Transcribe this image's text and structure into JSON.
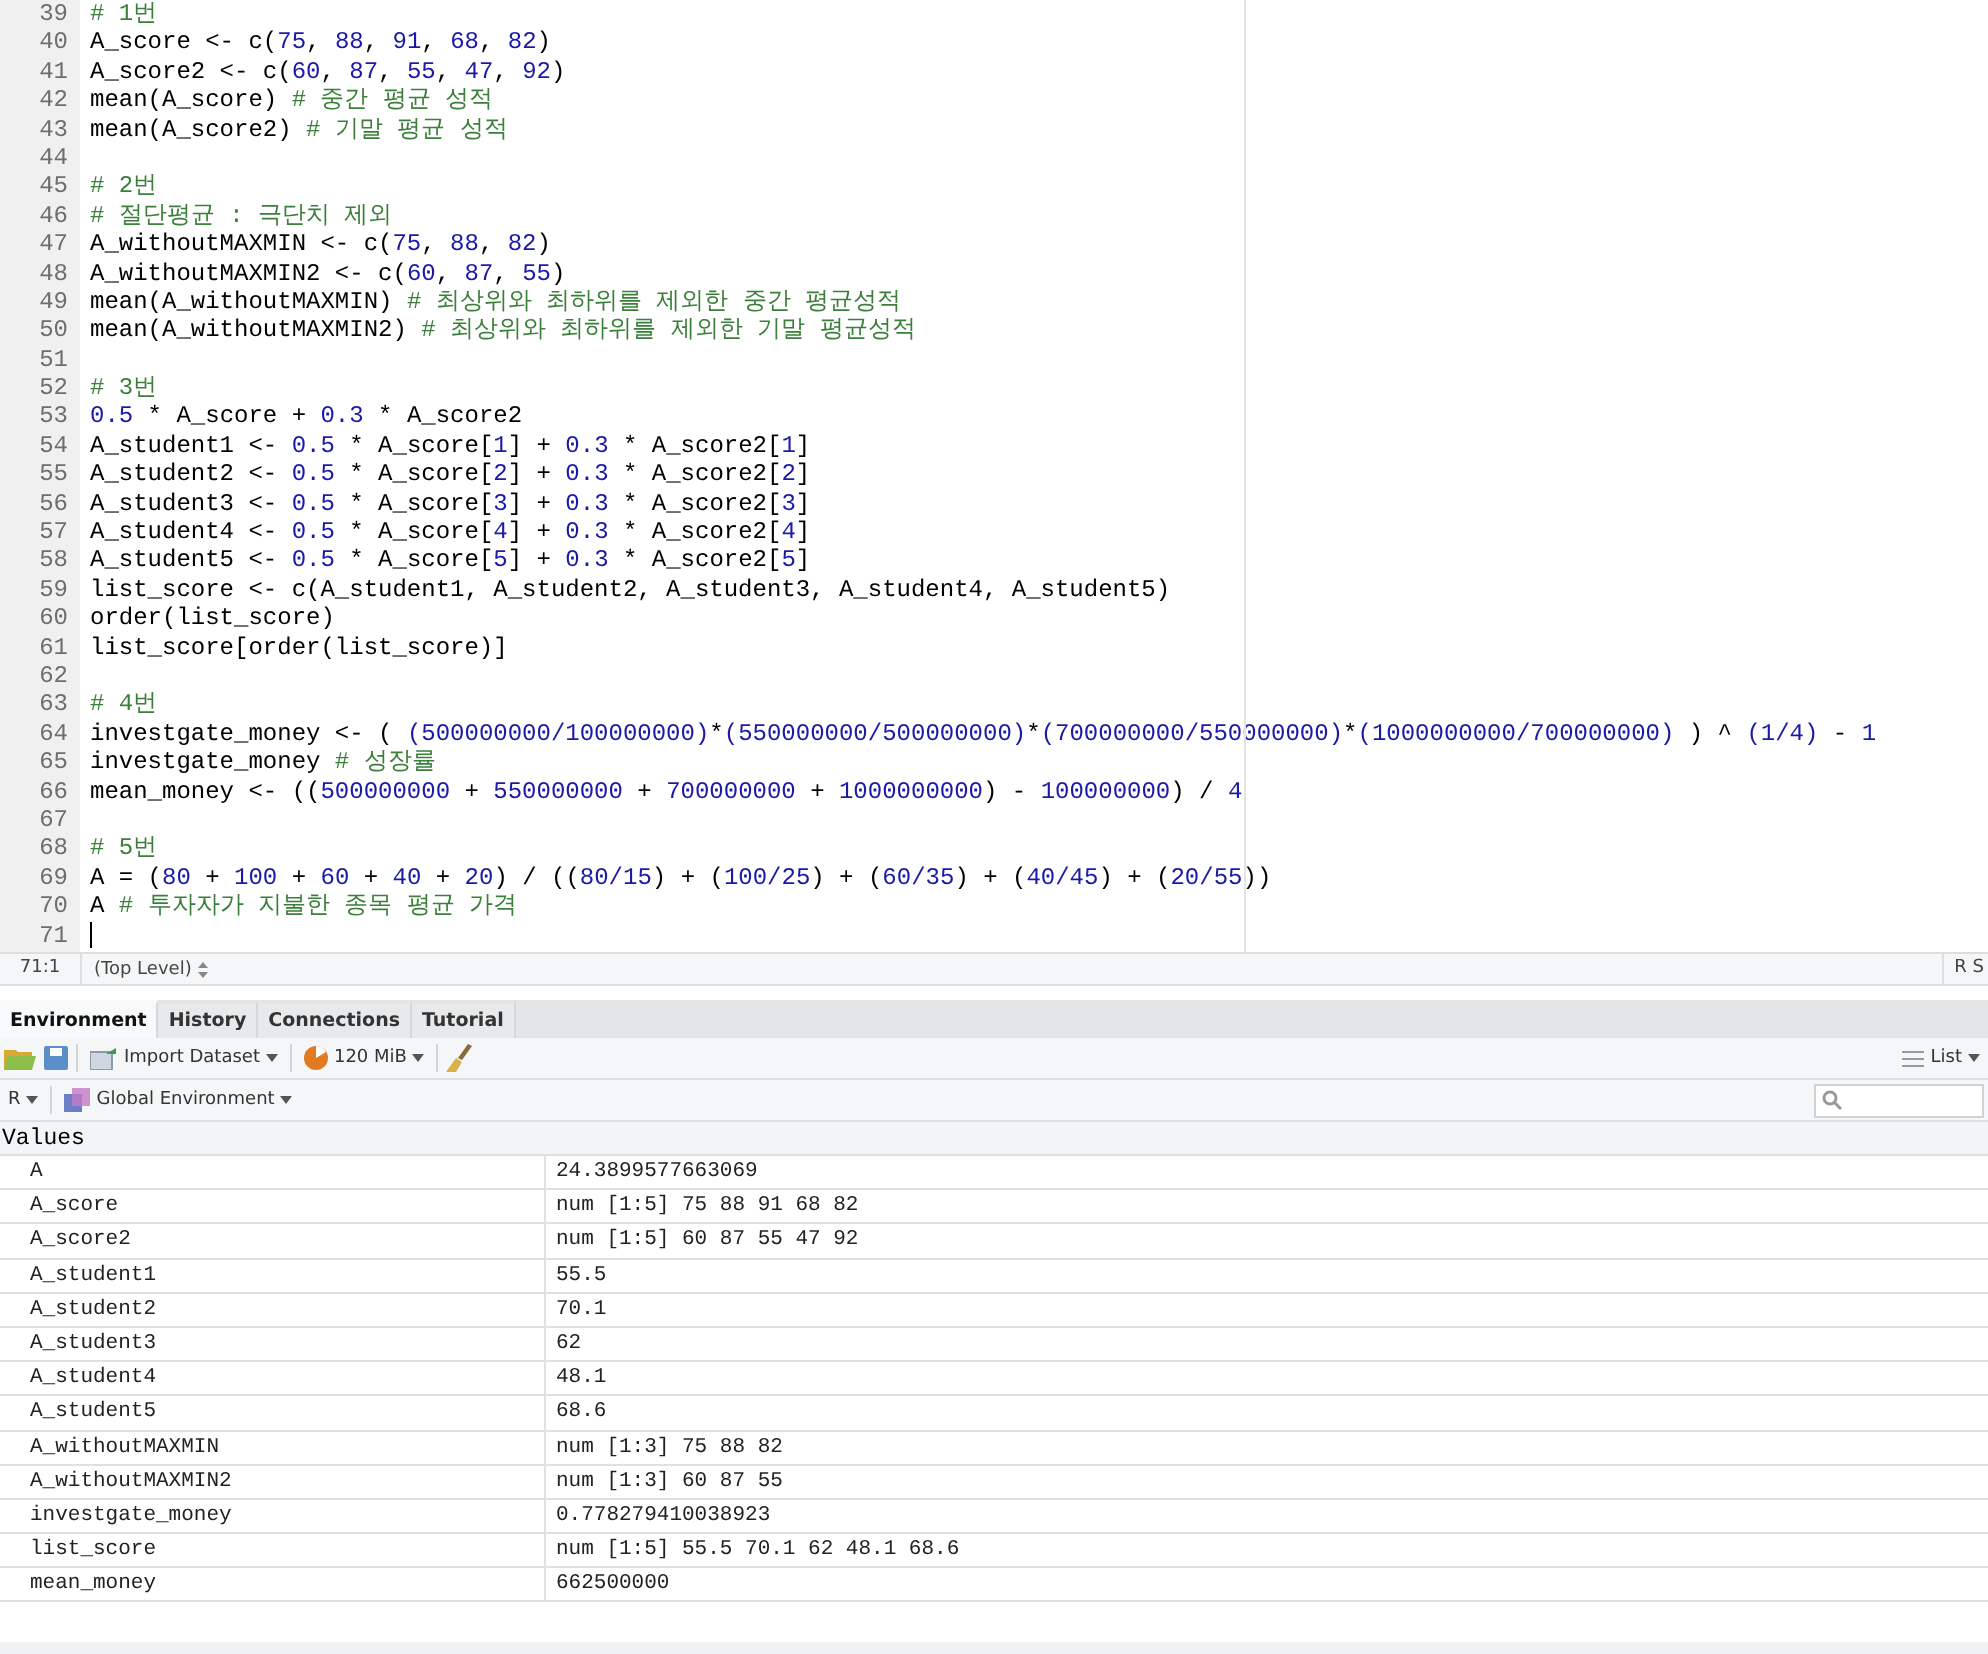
{
  "editor": {
    "lines": [
      {
        "number": "39",
        "segments": [
          {
            "kind": "comment",
            "text": "# 1번"
          }
        ]
      },
      {
        "number": "40",
        "segments": [
          {
            "kind": "code",
            "text": "A_score <- c("
          },
          {
            "kind": "number",
            "text": "75"
          },
          {
            "kind": "code",
            "text": ", "
          },
          {
            "kind": "number",
            "text": "88"
          },
          {
            "kind": "code",
            "text": ", "
          },
          {
            "kind": "number",
            "text": "91"
          },
          {
            "kind": "code",
            "text": ", "
          },
          {
            "kind": "number",
            "text": "68"
          },
          {
            "kind": "code",
            "text": ", "
          },
          {
            "kind": "number",
            "text": "82"
          },
          {
            "kind": "code",
            "text": ")"
          }
        ]
      },
      {
        "number": "41",
        "segments": [
          {
            "kind": "code",
            "text": "A_score2 <- c("
          },
          {
            "kind": "number",
            "text": "60"
          },
          {
            "kind": "code",
            "text": ", "
          },
          {
            "kind": "number",
            "text": "87"
          },
          {
            "kind": "code",
            "text": ", "
          },
          {
            "kind": "number",
            "text": "55"
          },
          {
            "kind": "code",
            "text": ", "
          },
          {
            "kind": "number",
            "text": "47"
          },
          {
            "kind": "code",
            "text": ", "
          },
          {
            "kind": "number",
            "text": "92"
          },
          {
            "kind": "code",
            "text": ")"
          }
        ]
      },
      {
        "number": "42",
        "segments": [
          {
            "kind": "code",
            "text": "mean(A_score) "
          },
          {
            "kind": "comment",
            "text": "# 중간 평균 성적"
          }
        ]
      },
      {
        "number": "43",
        "segments": [
          {
            "kind": "code",
            "text": "mean(A_score2) "
          },
          {
            "kind": "comment",
            "text": "# 기말 평균 성적"
          }
        ]
      },
      {
        "number": "44"
      },
      {
        "number": "45",
        "segments": [
          {
            "kind": "comment",
            "text": "# 2번"
          }
        ]
      },
      {
        "number": "46",
        "segments": [
          {
            "kind": "comment",
            "text": "# 절단평균 : 극단치 제외"
          }
        ]
      },
      {
        "number": "47",
        "segments": [
          {
            "kind": "code",
            "text": "A_withoutMAXMIN <- c("
          },
          {
            "kind": "number",
            "text": "75"
          },
          {
            "kind": "code",
            "text": ", "
          },
          {
            "kind": "number",
            "text": "88"
          },
          {
            "kind": "code",
            "text": ", "
          },
          {
            "kind": "number",
            "text": "82"
          },
          {
            "kind": "code",
            "text": ")"
          }
        ]
      },
      {
        "number": "48",
        "segments": [
          {
            "kind": "code",
            "text": "A_withoutMAXMIN2 <- c("
          },
          {
            "kind": "number",
            "text": "60"
          },
          {
            "kind": "code",
            "text": ", "
          },
          {
            "kind": "number",
            "text": "87"
          },
          {
            "kind": "code",
            "text": ", "
          },
          {
            "kind": "number",
            "text": "55"
          },
          {
            "kind": "code",
            "text": ")"
          }
        ]
      },
      {
        "number": "49",
        "segments": [
          {
            "kind": "code",
            "text": "mean(A_withoutMAXMIN) "
          },
          {
            "kind": "comment",
            "text": "# 최상위와 최하위를 제외한 중간 평균성적"
          }
        ]
      },
      {
        "number": "50",
        "segments": [
          {
            "kind": "code",
            "text": "mean(A_withoutMAXMIN2) "
          },
          {
            "kind": "comment",
            "text": "# 최상위와 최하위를 제외한 기말 평균성적"
          }
        ]
      },
      {
        "number": "51"
      },
      {
        "number": "52",
        "segments": [
          {
            "kind": "comment",
            "text": "# 3번"
          }
        ]
      },
      {
        "number": "53",
        "segments": [
          {
            "kind": "number",
            "text": "0.5"
          },
          {
            "kind": "code",
            "text": " * A_score + "
          },
          {
            "kind": "number",
            "text": "0.3"
          },
          {
            "kind": "code",
            "text": " * A_score2"
          }
        ]
      },
      {
        "number": "54",
        "segments": [
          {
            "kind": "code",
            "text": "A_student1 <- "
          },
          {
            "kind": "number",
            "text": "0.5"
          },
          {
            "kind": "code",
            "text": " * A_score["
          },
          {
            "kind": "number",
            "text": "1"
          },
          {
            "kind": "code",
            "text": "] + "
          },
          {
            "kind": "number",
            "text": "0.3"
          },
          {
            "kind": "code",
            "text": " * A_score2["
          },
          {
            "kind": "number",
            "text": "1"
          },
          {
            "kind": "code",
            "text": "]"
          }
        ]
      },
      {
        "number": "55",
        "segments": [
          {
            "kind": "code",
            "text": "A_student2 <- "
          },
          {
            "kind": "number",
            "text": "0.5"
          },
          {
            "kind": "code",
            "text": " * A_score["
          },
          {
            "kind": "number",
            "text": "2"
          },
          {
            "kind": "code",
            "text": "] + "
          },
          {
            "kind": "number",
            "text": "0.3"
          },
          {
            "kind": "code",
            "text": " * A_score2["
          },
          {
            "kind": "number",
            "text": "2"
          },
          {
            "kind": "code",
            "text": "]"
          }
        ]
      },
      {
        "number": "56",
        "segments": [
          {
            "kind": "code",
            "text": "A_student3 <- "
          },
          {
            "kind": "number",
            "text": "0.5"
          },
          {
            "kind": "code",
            "text": " * A_score["
          },
          {
            "kind": "number",
            "text": "3"
          },
          {
            "kind": "code",
            "text": "] + "
          },
          {
            "kind": "number",
            "text": "0.3"
          },
          {
            "kind": "code",
            "text": " * A_score2["
          },
          {
            "kind": "number",
            "text": "3"
          },
          {
            "kind": "code",
            "text": "]"
          }
        ]
      },
      {
        "number": "57",
        "segments": [
          {
            "kind": "code",
            "text": "A_student4 <- "
          },
          {
            "kind": "number",
            "text": "0.5"
          },
          {
            "kind": "code",
            "text": " * A_score["
          },
          {
            "kind": "number",
            "text": "4"
          },
          {
            "kind": "code",
            "text": "] + "
          },
          {
            "kind": "number",
            "text": "0.3"
          },
          {
            "kind": "code",
            "text": " * A_score2["
          },
          {
            "kind": "number",
            "text": "4"
          },
          {
            "kind": "code",
            "text": "]"
          }
        ]
      },
      {
        "number": "58",
        "segments": [
          {
            "kind": "code",
            "text": "A_student5 <- "
          },
          {
            "kind": "number",
            "text": "0.5"
          },
          {
            "kind": "code",
            "text": " * A_score["
          },
          {
            "kind": "number",
            "text": "5"
          },
          {
            "kind": "code",
            "text": "] + "
          },
          {
            "kind": "number",
            "text": "0.3"
          },
          {
            "kind": "code",
            "text": " * A_score2["
          },
          {
            "kind": "number",
            "text": "5"
          },
          {
            "kind": "code",
            "text": "]"
          }
        ]
      },
      {
        "number": "59",
        "segments": [
          {
            "kind": "code",
            "text": "list_score <- c(A_student1, A_student2, A_student3, A_student4, A_student5)"
          }
        ]
      },
      {
        "number": "60",
        "segments": [
          {
            "kind": "code",
            "text": "order(list_score)"
          }
        ]
      },
      {
        "number": "61",
        "segments": [
          {
            "kind": "code",
            "text": "list_score[order(list_score)]"
          }
        ]
      },
      {
        "number": "62"
      },
      {
        "number": "63",
        "segments": [
          {
            "kind": "comment",
            "text": "# 4번"
          }
        ]
      },
      {
        "number": "64",
        "segments": [
          {
            "kind": "code",
            "text": "investgate_money <- ( "
          },
          {
            "kind": "number",
            "text": "(500000000/100000000)"
          },
          {
            "kind": "code",
            "text": "*"
          },
          {
            "kind": "number",
            "text": "(550000000/500000000)"
          },
          {
            "kind": "code",
            "text": "*"
          },
          {
            "kind": "number",
            "text": "(700000000/550000000)"
          },
          {
            "kind": "code",
            "text": "*"
          },
          {
            "kind": "number",
            "text": "(1000000000/700000000)"
          },
          {
            "kind": "code",
            "text": " ) ^ "
          },
          {
            "kind": "number",
            "text": "(1/4)"
          },
          {
            "kind": "code",
            "text": " - "
          },
          {
            "kind": "number",
            "text": "1"
          }
        ]
      },
      {
        "number": "65",
        "segments": [
          {
            "kind": "code",
            "text": "investgate_money "
          },
          {
            "kind": "comment",
            "text": "# 성장률"
          }
        ]
      },
      {
        "number": "66",
        "segments": [
          {
            "kind": "code",
            "text": "mean_money <- (("
          },
          {
            "kind": "number",
            "text": "500000000"
          },
          {
            "kind": "code",
            "text": " + "
          },
          {
            "kind": "number",
            "text": "550000000"
          },
          {
            "kind": "code",
            "text": " + "
          },
          {
            "kind": "number",
            "text": "700000000"
          },
          {
            "kind": "code",
            "text": " + "
          },
          {
            "kind": "number",
            "text": "1000000000"
          },
          {
            "kind": "code",
            "text": ") - "
          },
          {
            "kind": "number",
            "text": "100000000"
          },
          {
            "kind": "code",
            "text": ") / "
          },
          {
            "kind": "number",
            "text": "4"
          }
        ]
      },
      {
        "number": "67"
      },
      {
        "number": "68",
        "segments": [
          {
            "kind": "comment",
            "text": "# 5번"
          }
        ]
      },
      {
        "number": "69",
        "segments": [
          {
            "kind": "code",
            "text": "A = ("
          },
          {
            "kind": "number",
            "text": "80"
          },
          {
            "kind": "code",
            "text": " + "
          },
          {
            "kind": "number",
            "text": "100"
          },
          {
            "kind": "code",
            "text": " + "
          },
          {
            "kind": "number",
            "text": "60"
          },
          {
            "kind": "code",
            "text": " + "
          },
          {
            "kind": "number",
            "text": "40"
          },
          {
            "kind": "code",
            "text": " + "
          },
          {
            "kind": "number",
            "text": "20"
          },
          {
            "kind": "code",
            "text": ") / (("
          },
          {
            "kind": "number",
            "text": "80/15"
          },
          {
            "kind": "code",
            "text": ") + ("
          },
          {
            "kind": "number",
            "text": "100/25"
          },
          {
            "kind": "code",
            "text": ") + ("
          },
          {
            "kind": "number",
            "text": "60/35"
          },
          {
            "kind": "code",
            "text": ") + ("
          },
          {
            "kind": "number",
            "text": "40/45"
          },
          {
            "kind": "code",
            "text": ") + ("
          },
          {
            "kind": "number",
            "text": "20/55"
          },
          {
            "kind": "code",
            "text": "))"
          }
        ]
      },
      {
        "number": "70",
        "segments": [
          {
            "kind": "code",
            "text": "A "
          },
          {
            "kind": "comment",
            "text": "# 투자자가 지불한 종목 평균 가격"
          }
        ]
      },
      {
        "number": "71",
        "cursor": true
      }
    ]
  },
  "status_bar": {
    "position": "71:1",
    "scope": "(Top Level)",
    "right_label": "R S"
  },
  "environment_pane": {
    "tabs": [
      {
        "label": "Environment",
        "selected": true
      },
      {
        "label": "History",
        "selected": false
      },
      {
        "label": "Connections",
        "selected": false
      },
      {
        "label": "Tutorial",
        "selected": false
      }
    ],
    "toolbar": {
      "import_label": "Import Dataset",
      "memory_label": "120 MiB",
      "view_label": "List"
    },
    "language": "R",
    "scope": "Global Environment",
    "section_header": "Values",
    "rows": [
      {
        "name": "A",
        "value": "24.3899577663069"
      },
      {
        "name": "A_score",
        "value": "num [1:5] 75 88 91 68 82"
      },
      {
        "name": "A_score2",
        "value": "num [1:5] 60 87 55 47 92"
      },
      {
        "name": "A_student1",
        "value": "55.5"
      },
      {
        "name": "A_student2",
        "value": "70.1"
      },
      {
        "name": "A_student3",
        "value": "62"
      },
      {
        "name": "A_student4",
        "value": "48.1"
      },
      {
        "name": "A_student5",
        "value": "68.6"
      },
      {
        "name": "A_withoutMAXMIN",
        "value": "num [1:3] 75 88 82"
      },
      {
        "name": "A_withoutMAXMIN2",
        "value": "num [1:3] 60 87 55"
      },
      {
        "name": "investgate_money",
        "value": "0.778279410038923"
      },
      {
        "name": "list_score",
        "value": "num [1:5] 55.5 70.1 62 48.1 68.6"
      },
      {
        "name": "mean_money",
        "value": "662500000"
      }
    ]
  }
}
